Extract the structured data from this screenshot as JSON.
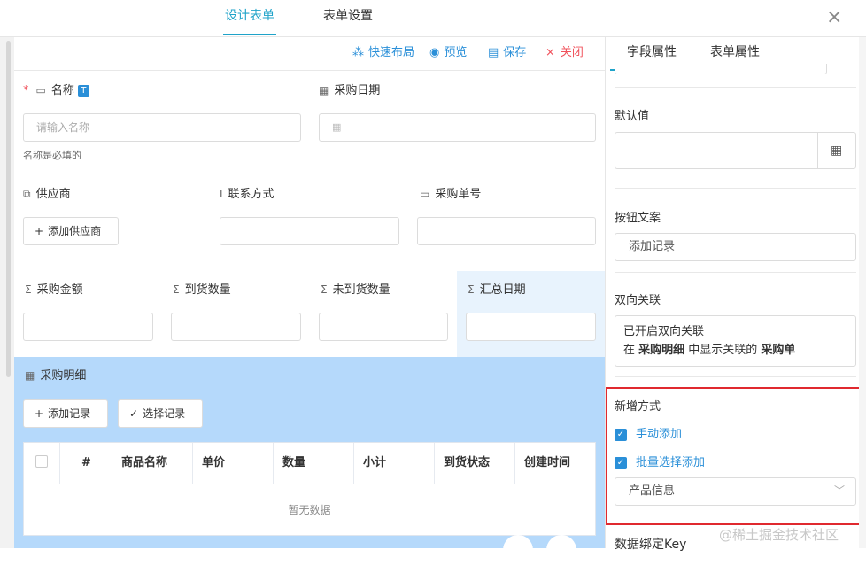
{
  "header": {
    "tabs": [
      {
        "label": "设计表单"
      },
      {
        "label": "表单设置"
      }
    ],
    "close": "×"
  },
  "toolbar": {
    "layout_icon": "⁂",
    "layout": "快速布局",
    "preview_icon": "◉",
    "preview": "预览",
    "save_icon": "▤",
    "save": "保存",
    "close_icon": "×",
    "close": "关闭"
  },
  "form": {
    "name": {
      "required": "*",
      "label": "名称",
      "type_badge": "T",
      "placeholder": "请输入名称",
      "help": "名称是必填的"
    },
    "date": {
      "label": "采购日期"
    },
    "supplier": {
      "label": "供应商",
      "button": "添加供应商"
    },
    "contact": {
      "label": "联系方式"
    },
    "order_no": {
      "label": "采购单号"
    },
    "amount": {
      "label": "采购金额"
    },
    "arrived": {
      "label": "到货数量"
    },
    "not_arrived": {
      "label": "未到货数量"
    },
    "summary_date": {
      "label": "汇总日期"
    },
    "detail": {
      "label": "采购明细",
      "add_button": "添加记录",
      "select_button": "选择记录",
      "columns": [
        "#",
        "商品名称",
        "单价",
        "数量",
        "小计",
        "到货状态",
        "创建时间"
      ],
      "empty": "暂无数据"
    }
  },
  "panel": {
    "tabs": [
      {
        "label": "字段属性"
      },
      {
        "label": "表单属性"
      }
    ],
    "default_label": "默认值",
    "button_text_label": "按钮文案",
    "button_text_value": "添加记录",
    "relation_label": "双向关联",
    "relation_line1": "已开启双向关联",
    "relation_line2_pre": "在 ",
    "relation_line2_b1": "采购明细",
    "relation_line2_mid": " 中显示关联的 ",
    "relation_line2_b2": "采购单",
    "add_mode_label": "新增方式",
    "manual_add": "手动添加",
    "batch_add": "批量选择添加",
    "source": "产品信息",
    "bind_key_label": "数据绑定Key"
  },
  "watermark": "@稀土掘金技术社区",
  "colors": {
    "accent": "#1fa3c9",
    "link": "#2a8fd8",
    "danger": "#f0505a",
    "subform_bg": "#b5d9fb",
    "highlight_bg": "#e8f3fd",
    "annotation_red": "#e0292f"
  }
}
